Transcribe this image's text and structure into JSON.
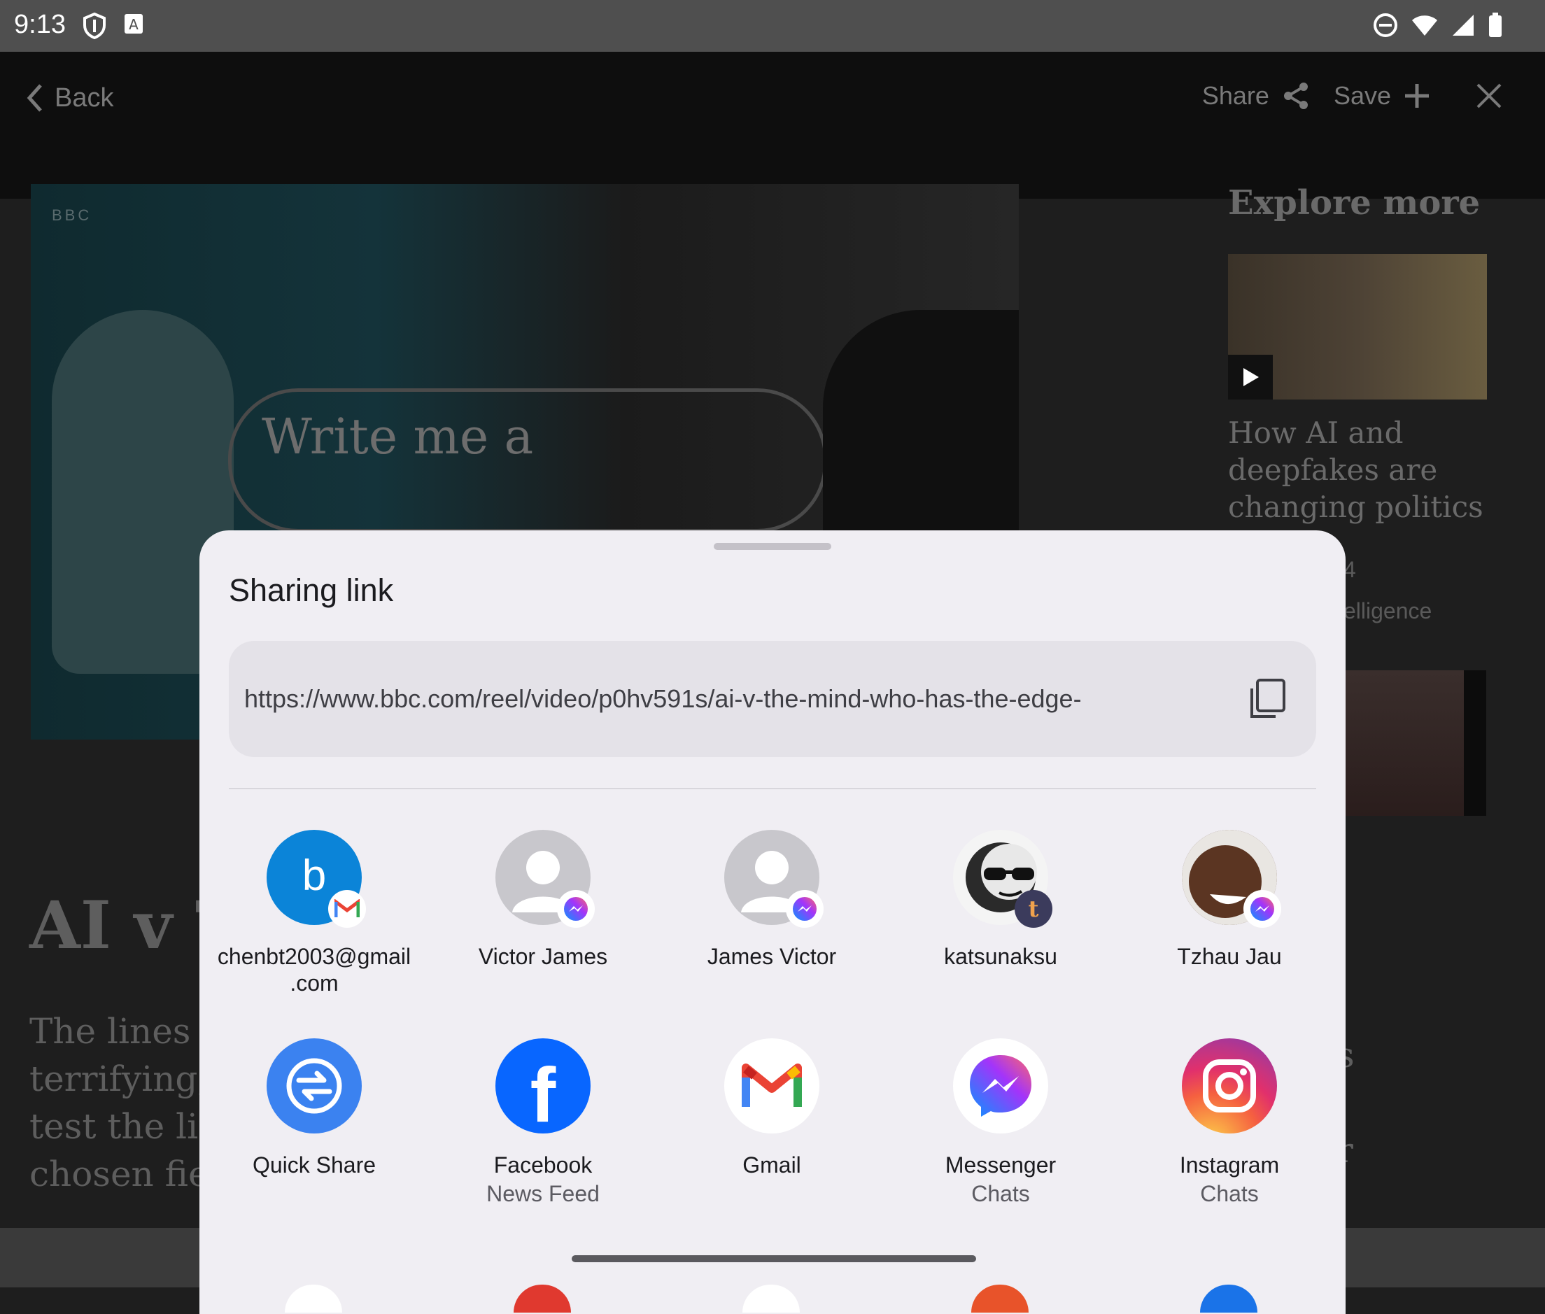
{
  "status_bar": {
    "time": "9:13"
  },
  "app": {
    "nav": {
      "back_label": "Back",
      "share_label": "Share",
      "save_label": "Save"
    },
    "hero": {
      "logo": "BBC",
      "pill_text": "Write me a"
    },
    "article": {
      "title_partial": "AI v T",
      "body_lines": [
        "The lines b",
        "terrifying, ",
        "test the lim",
        "chosen fiel"
      ],
      "body_right": [
        "s",
        "r"
      ]
    },
    "explore": {
      "title": "Explore more",
      "headline": "How AI and deepfakes are changing politics",
      "meta_1": "4",
      "meta_2": "elligence"
    }
  },
  "share_sheet": {
    "title": "Sharing link",
    "link": "https://www.bbc.com/reel/video/p0hv591s/ai-v-the-mind-who-has-the-edge-",
    "contacts": [
      {
        "name_line1": "chenbt2003@gmail",
        "name_line2": ".com",
        "avatar_letter": "b",
        "badge": "gmail-icon",
        "color": "#0b84d8"
      },
      {
        "name_line1": "Victor James",
        "badge": "messenger-icon"
      },
      {
        "name_line1": "James Victor",
        "badge": "messenger-icon"
      },
      {
        "name_line1": "katsunaksu",
        "badge": "tumblr-icon"
      },
      {
        "name_line1": "Tzhau Jau",
        "badge": "messenger-icon"
      }
    ],
    "apps": [
      {
        "label": "Quick Share",
        "sub": "",
        "icon": "quick-share-icon",
        "color": "#3b82f0"
      },
      {
        "label": "Facebook",
        "sub": "News Feed",
        "icon": "facebook-icon",
        "color": "#0866ff"
      },
      {
        "label": "Gmail",
        "sub": "",
        "icon": "gmail-icon",
        "color": "#ffffff"
      },
      {
        "label": "Messenger",
        "sub": "Chats",
        "icon": "messenger-icon",
        "color": "#ffffff"
      },
      {
        "label": "Instagram",
        "sub": "Chats",
        "icon": "instagram-icon",
        "color": "#e1306c"
      }
    ]
  }
}
